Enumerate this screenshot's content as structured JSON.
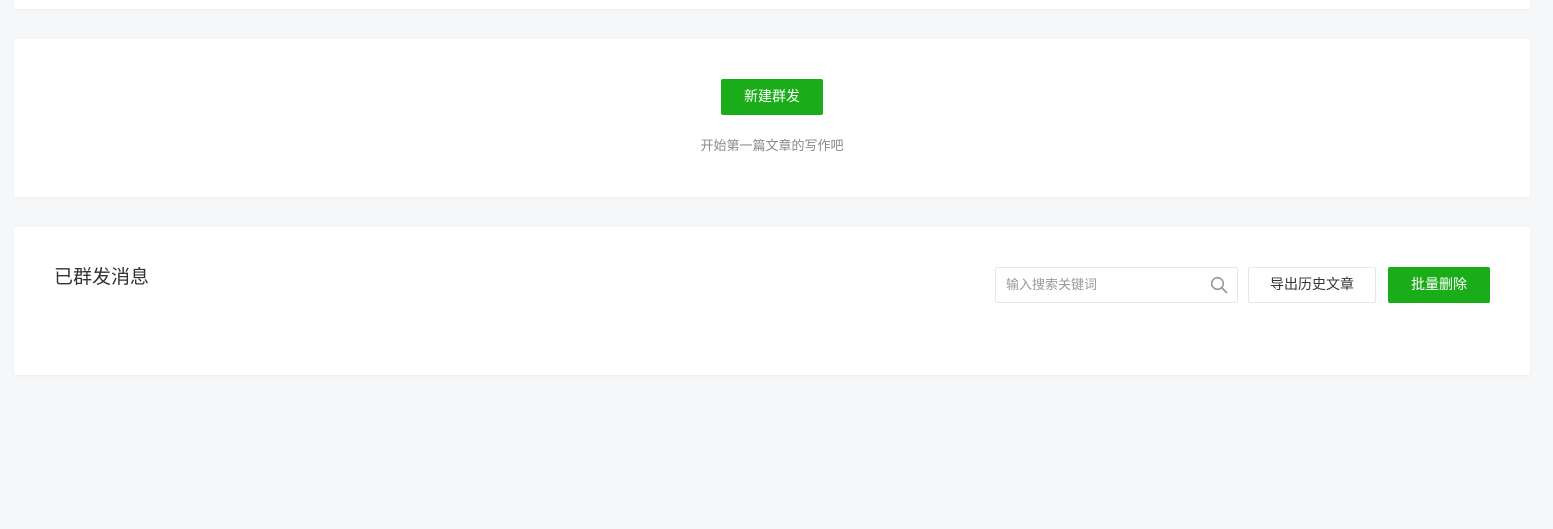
{
  "new_mass": {
    "button_label": "新建群发",
    "hint": "开始第一篇文章的写作吧"
  },
  "sent_messages": {
    "title": "已群发消息",
    "search": {
      "placeholder": "输入搜索关键词",
      "value": ""
    },
    "export_label": "导出历史文章",
    "batch_delete_label": "批量删除"
  },
  "colors": {
    "accent": "#1aad19",
    "background": "#f6f7f9",
    "card": "#ffffff"
  },
  "icons": {
    "search": "search-icon"
  }
}
